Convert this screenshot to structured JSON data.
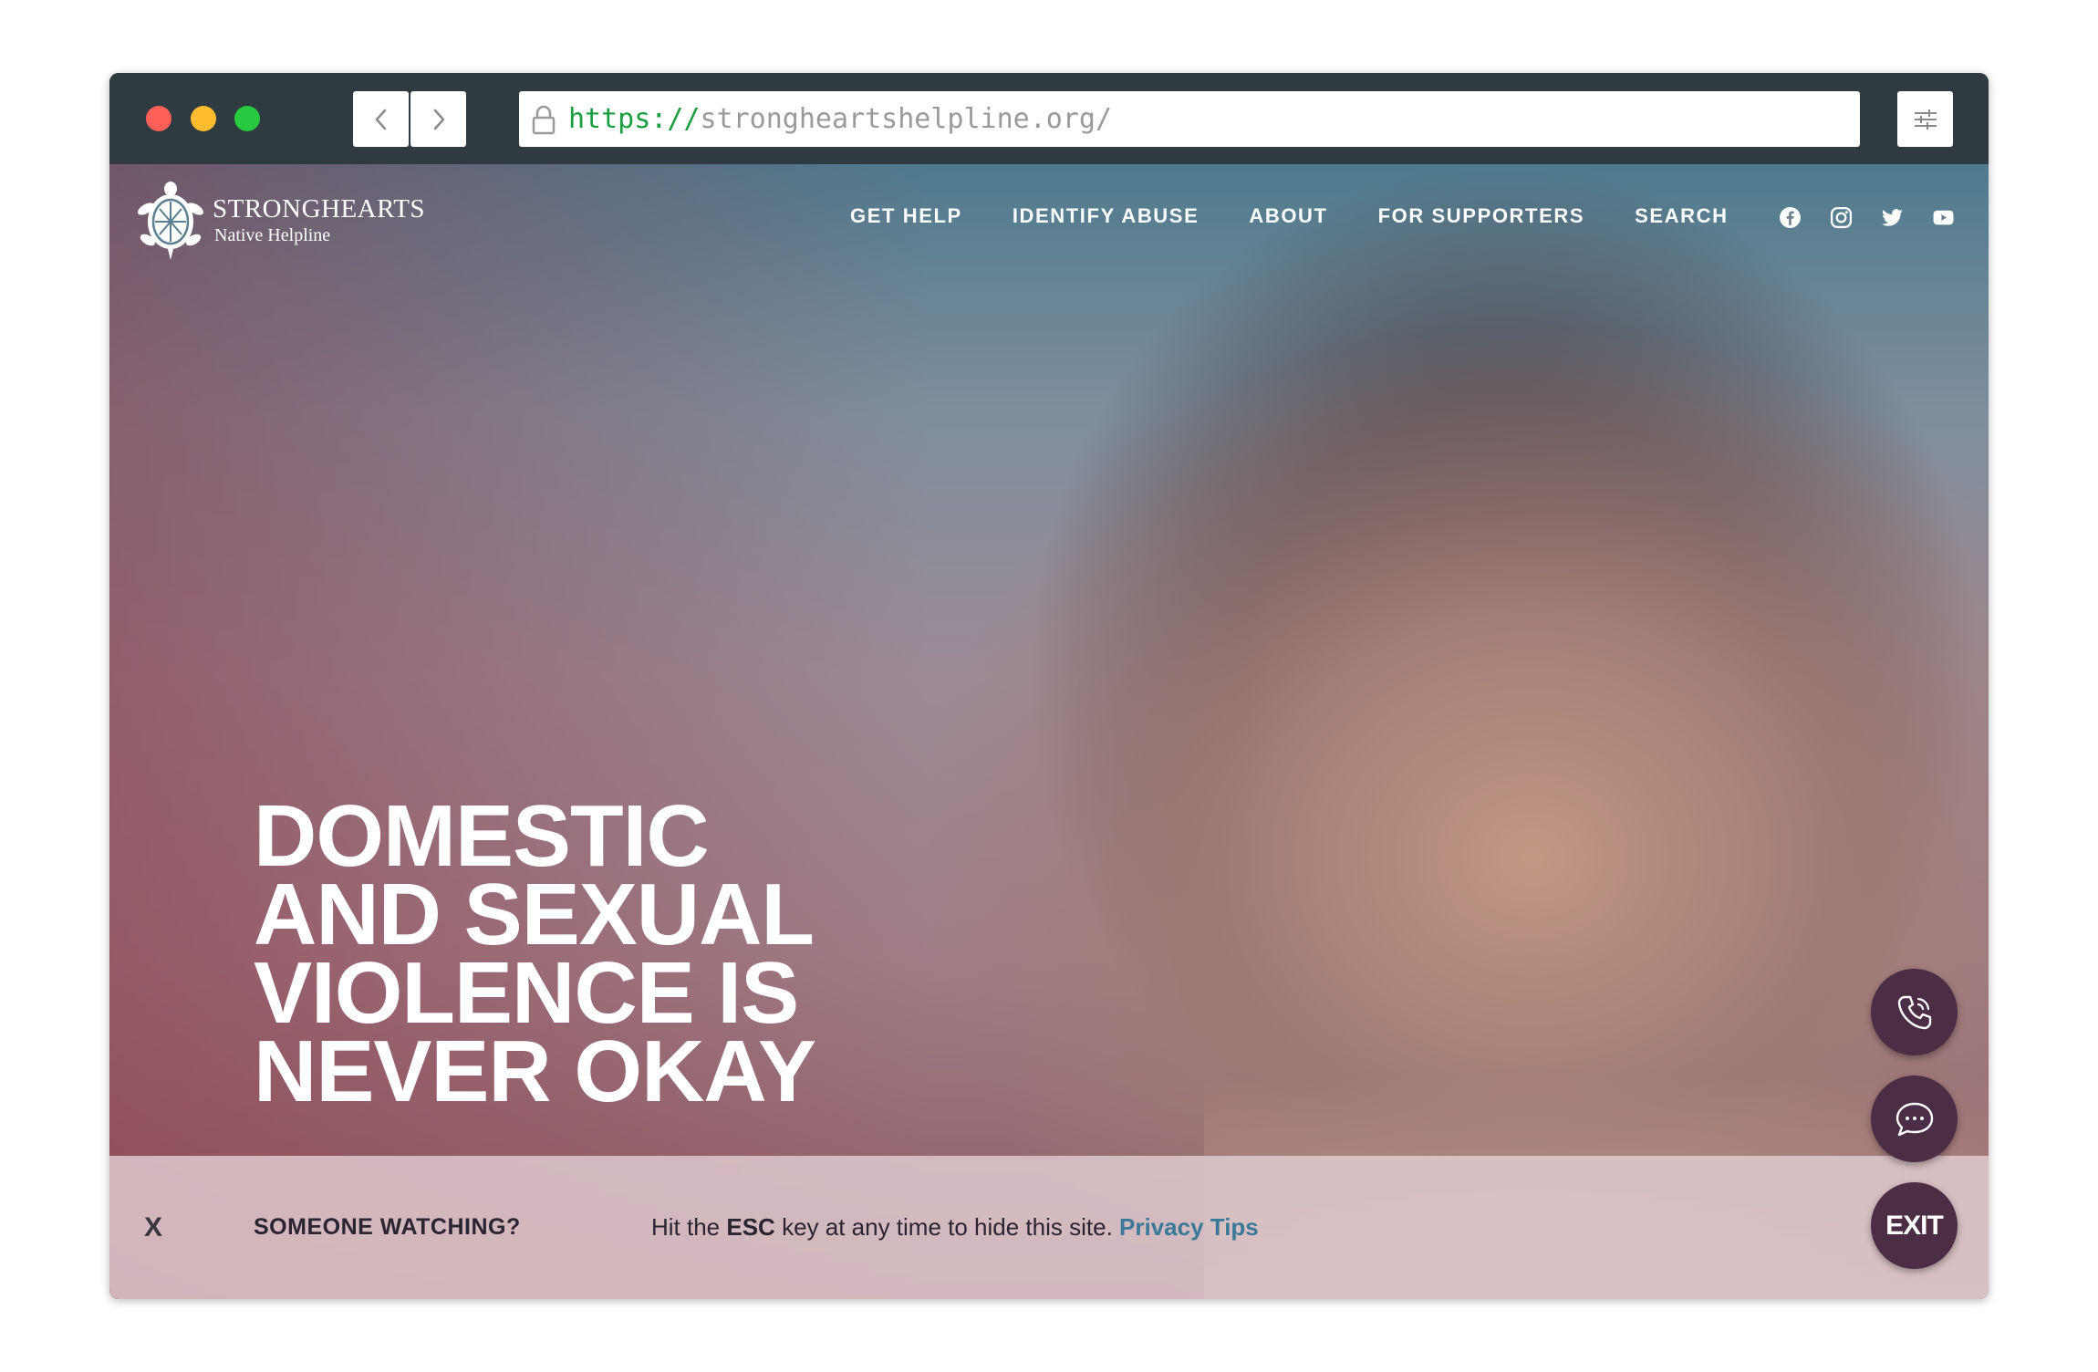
{
  "browser": {
    "url_scheme": "https://",
    "url_host": "strongheartshelpline.org/"
  },
  "site": {
    "logo_name": "STRONGHEARTS",
    "logo_sub": "Native Helpline",
    "nav": [
      "GET HELP",
      "IDENTIFY ABUSE",
      "ABOUT",
      "FOR SUPPORTERS",
      "SEARCH"
    ],
    "social_icons": [
      "facebook-icon",
      "instagram-icon",
      "twitter-icon",
      "youtube-icon"
    ]
  },
  "hero": {
    "headline_lines": [
      "DOMESTIC",
      "AND SEXUAL",
      "VIOLENCE IS",
      "NEVER OKAY"
    ]
  },
  "fabs": {
    "exit_label": "EXIT"
  },
  "privacy_bar": {
    "close_label": "X",
    "title": "SOMEONE WATCHING?",
    "msg_pre": "Hit the ",
    "msg_key": "ESC",
    "msg_post": " key at any time to hide this site. ",
    "link": "Privacy Tips"
  },
  "colors": {
    "chrome": "#2f3a41",
    "fab": "#4b2d46",
    "link": "#3a7a98",
    "url_scheme": "#1a9e3f"
  }
}
